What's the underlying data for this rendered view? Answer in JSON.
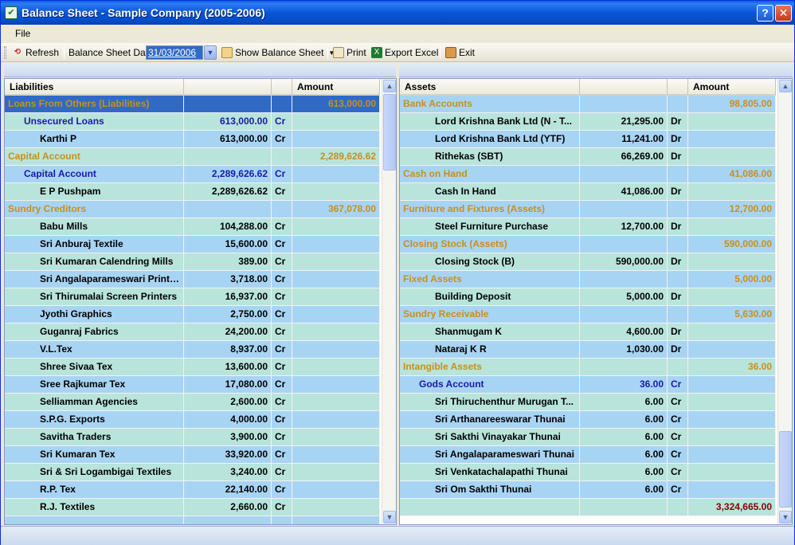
{
  "window": {
    "title": "Balance Sheet - Sample Company (2005-2006)",
    "help_glyph": "?",
    "close_glyph": "✕"
  },
  "menu": {
    "file_label": "File"
  },
  "toolbar": {
    "refresh_label": "Refresh",
    "date_label": "Balance Sheet Date",
    "date_value": "31/03/2006",
    "show_label": "Show Balance Sheet",
    "print_label": "Print",
    "export_label": "Export Excel",
    "exit_label": "Exit"
  },
  "liabilities": {
    "headers": [
      "Liabilities",
      "",
      "",
      "Amount"
    ],
    "rows": [
      {
        "level": "group",
        "name": "Loans From Others (Liabilities)",
        "sub": "",
        "drcr": "",
        "total": "613,000.00",
        "selected": true
      },
      {
        "level": "sub",
        "name": "Unsecured Loans",
        "sub": "613,000.00",
        "drcr": "Cr",
        "total": ""
      },
      {
        "level": "item",
        "name": "Karthi P",
        "sub": "613,000.00",
        "drcr": "Cr",
        "total": ""
      },
      {
        "level": "group",
        "name": "Capital Account",
        "sub": "",
        "drcr": "",
        "total": "2,289,626.62"
      },
      {
        "level": "sub",
        "name": "Capital Account",
        "sub": "2,289,626.62",
        "drcr": "Cr",
        "total": ""
      },
      {
        "level": "item",
        "name": "E P Pushpam",
        "sub": "2,289,626.62",
        "drcr": "Cr",
        "total": ""
      },
      {
        "level": "group",
        "name": "Sundry Creditors",
        "sub": "",
        "drcr": "",
        "total": "367,078.00"
      },
      {
        "level": "item",
        "name": "Babu Mills",
        "sub": "104,288.00",
        "drcr": "Cr",
        "total": ""
      },
      {
        "level": "item",
        "name": "Sri Anburaj Textile",
        "sub": "15,600.00",
        "drcr": "Cr",
        "total": ""
      },
      {
        "level": "item",
        "name": "Sri Kumaran Calendring Mills",
        "sub": "389.00",
        "drcr": "Cr",
        "total": ""
      },
      {
        "level": "item",
        "name": "Sri Angalaparameswari Printi...",
        "sub": "3,718.00",
        "drcr": "Cr",
        "total": ""
      },
      {
        "level": "item",
        "name": "Sri Thirumalai Screen Printers",
        "sub": "16,937.00",
        "drcr": "Cr",
        "total": ""
      },
      {
        "level": "item",
        "name": "Jyothi Graphics",
        "sub": "2,750.00",
        "drcr": "Cr",
        "total": ""
      },
      {
        "level": "item",
        "name": "Guganraj Fabrics",
        "sub": "24,200.00",
        "drcr": "Cr",
        "total": ""
      },
      {
        "level": "item",
        "name": "V.L.Tex",
        "sub": "8,937.00",
        "drcr": "Cr",
        "total": ""
      },
      {
        "level": "item",
        "name": "Shree Sivaa Tex",
        "sub": "13,600.00",
        "drcr": "Cr",
        "total": ""
      },
      {
        "level": "item",
        "name": "Sree Rajkumar Tex",
        "sub": "17,080.00",
        "drcr": "Cr",
        "total": ""
      },
      {
        "level": "item",
        "name": "Selliamman Agencies",
        "sub": "2,600.00",
        "drcr": "Cr",
        "total": ""
      },
      {
        "level": "item",
        "name": "S.P.G. Exports",
        "sub": "4,000.00",
        "drcr": "Cr",
        "total": ""
      },
      {
        "level": "item",
        "name": "Savitha Traders",
        "sub": "3,900.00",
        "drcr": "Cr",
        "total": ""
      },
      {
        "level": "item",
        "name": "Sri Kumaran Tex",
        "sub": "33,920.00",
        "drcr": "Cr",
        "total": ""
      },
      {
        "level": "item",
        "name": "Sri & Sri Logambigai Textiles",
        "sub": "3,240.00",
        "drcr": "Cr",
        "total": ""
      },
      {
        "level": "item",
        "name": "R.P. Tex",
        "sub": "22,140.00",
        "drcr": "Cr",
        "total": ""
      },
      {
        "level": "item",
        "name": "R.J. Textiles",
        "sub": "2,660.00",
        "drcr": "Cr",
        "total": ""
      },
      {
        "level": "item",
        "name": "",
        "sub": "",
        "drcr": "",
        "total": ""
      }
    ]
  },
  "assets": {
    "headers": [
      "Assets",
      "",
      "",
      "Amount"
    ],
    "rows": [
      {
        "level": "group",
        "name": "Bank Accounts",
        "sub": "",
        "drcr": "",
        "total": "98,805.00"
      },
      {
        "level": "item",
        "name": "Lord Krishna Bank Ltd (N - T...",
        "sub": "21,295.00",
        "drcr": "Dr",
        "total": ""
      },
      {
        "level": "item",
        "name": "Lord Krishna Bank Ltd (YTF)",
        "sub": "11,241.00",
        "drcr": "Dr",
        "total": ""
      },
      {
        "level": "item",
        "name": "Rithekas (SBT)",
        "sub": "66,269.00",
        "drcr": "Dr",
        "total": ""
      },
      {
        "level": "group",
        "name": "Cash on Hand",
        "sub": "",
        "drcr": "",
        "total": "41,086.00"
      },
      {
        "level": "item",
        "name": "Cash In Hand",
        "sub": "41,086.00",
        "drcr": "Dr",
        "total": ""
      },
      {
        "level": "group",
        "name": "Furniture and Fixtures (Assets)",
        "sub": "",
        "drcr": "",
        "total": "12,700.00"
      },
      {
        "level": "item",
        "name": "Steel Furniture Purchase",
        "sub": "12,700.00",
        "drcr": "Dr",
        "total": ""
      },
      {
        "level": "group",
        "name": "Closing Stock (Assets)",
        "sub": "",
        "drcr": "",
        "total": "590,000.00"
      },
      {
        "level": "item",
        "name": "Closing Stock (B)",
        "sub": "590,000.00",
        "drcr": "Dr",
        "total": ""
      },
      {
        "level": "group",
        "name": "Fixed Assets",
        "sub": "",
        "drcr": "",
        "total": "5,000.00"
      },
      {
        "level": "item",
        "name": "Building Deposit",
        "sub": "5,000.00",
        "drcr": "Dr",
        "total": ""
      },
      {
        "level": "group",
        "name": "Sundry Receivable",
        "sub": "",
        "drcr": "",
        "total": "5,630.00"
      },
      {
        "level": "item",
        "name": "Shanmugam K",
        "sub": "4,600.00",
        "drcr": "Dr",
        "total": ""
      },
      {
        "level": "item",
        "name": "Nataraj K R",
        "sub": "1,030.00",
        "drcr": "Dr",
        "total": ""
      },
      {
        "level": "group",
        "name": "Intangible Assets",
        "sub": "",
        "drcr": "",
        "total": "36.00"
      },
      {
        "level": "sub",
        "name": "Gods Account",
        "sub": "36.00",
        "drcr": "Cr",
        "total": ""
      },
      {
        "level": "item",
        "name": "Sri Thiruchenthur Murugan T...",
        "sub": "6.00",
        "drcr": "Cr",
        "total": ""
      },
      {
        "level": "item",
        "name": "Sri Arthanareeswarar Thunai",
        "sub": "6.00",
        "drcr": "Cr",
        "total": ""
      },
      {
        "level": "item",
        "name": "Sri Sakthi Vinayakar Thunai",
        "sub": "6.00",
        "drcr": "Cr",
        "total": ""
      },
      {
        "level": "item",
        "name": "Sri Angalaparameswari Thunai",
        "sub": "6.00",
        "drcr": "Cr",
        "total": ""
      },
      {
        "level": "item",
        "name": "Sri Venkatachalapathi Thunai",
        "sub": "6.00",
        "drcr": "Cr",
        "total": ""
      },
      {
        "level": "item",
        "name": "Sri Om Sakthi Thunai",
        "sub": "6.00",
        "drcr": "Cr",
        "total": ""
      },
      {
        "level": "total",
        "name": "",
        "sub": "",
        "drcr": "",
        "total": "3,324,665.00"
      }
    ]
  }
}
